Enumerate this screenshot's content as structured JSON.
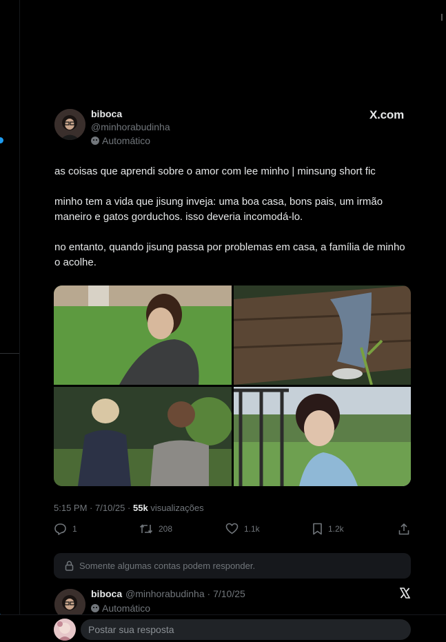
{
  "tweet": {
    "author_name": "biboca",
    "author_handle": "@minhorabudinha",
    "automated_label": "Automático",
    "source_label": "X.com",
    "paragraphs": [
      "as coisas que aprendi sobre o amor com lee minho | minsung short fic",
      "minho tem a vida que jisung inveja: uma boa casa, bons pais, um irmão maneiro e gatos gorduchos. isso deveria incomodá-lo.",
      "no entanto, quando jisung passa por problemas em casa, a família de minho o acolhe."
    ],
    "time": "5:15 PM",
    "date": "7/10/25",
    "views_count": "55k",
    "views_label": "visualizações",
    "separator": "·"
  },
  "actions": {
    "replies": "1",
    "reposts": "208",
    "likes": "1.1k",
    "bookmarks": "1.2k"
  },
  "reply_restriction": "Somente algumas contas podem responder.",
  "thread_preview": {
    "author_name": "biboca",
    "author_handle": "@minhorabudinha",
    "date": "· 7/10/25",
    "automated_label": "Automático"
  },
  "compose": {
    "placeholder": "Postar sua resposta"
  },
  "colors": {
    "background": "#000000",
    "text": "#e7e9ea",
    "muted": "#71767b",
    "accent": "#1d9bf0",
    "surface": "#16181c"
  },
  "icons": [
    "reply-icon",
    "repost-icon",
    "like-icon",
    "bookmark-icon",
    "share-icon",
    "lock-icon",
    "bot-icon",
    "x-logo-icon"
  ]
}
